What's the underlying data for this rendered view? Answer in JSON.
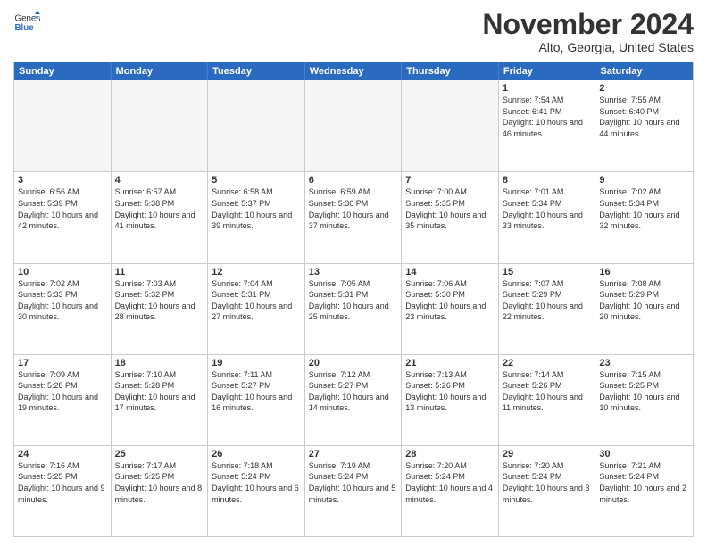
{
  "logo": {
    "general": "General",
    "blue": "Blue"
  },
  "title": "November 2024",
  "location": "Alto, Georgia, United States",
  "days_of_week": [
    "Sunday",
    "Monday",
    "Tuesday",
    "Wednesday",
    "Thursday",
    "Friday",
    "Saturday"
  ],
  "weeks": [
    [
      {
        "day": "",
        "empty": true
      },
      {
        "day": "",
        "empty": true
      },
      {
        "day": "",
        "empty": true
      },
      {
        "day": "",
        "empty": true
      },
      {
        "day": "",
        "empty": true
      },
      {
        "day": "1",
        "sunrise": "Sunrise: 7:54 AM",
        "sunset": "Sunset: 6:41 PM",
        "daylight": "Daylight: 10 hours and 46 minutes."
      },
      {
        "day": "2",
        "sunrise": "Sunrise: 7:55 AM",
        "sunset": "Sunset: 6:40 PM",
        "daylight": "Daylight: 10 hours and 44 minutes."
      }
    ],
    [
      {
        "day": "3",
        "sunrise": "Sunrise: 6:56 AM",
        "sunset": "Sunset: 5:39 PM",
        "daylight": "Daylight: 10 hours and 42 minutes."
      },
      {
        "day": "4",
        "sunrise": "Sunrise: 6:57 AM",
        "sunset": "Sunset: 5:38 PM",
        "daylight": "Daylight: 10 hours and 41 minutes."
      },
      {
        "day": "5",
        "sunrise": "Sunrise: 6:58 AM",
        "sunset": "Sunset: 5:37 PM",
        "daylight": "Daylight: 10 hours and 39 minutes."
      },
      {
        "day": "6",
        "sunrise": "Sunrise: 6:59 AM",
        "sunset": "Sunset: 5:36 PM",
        "daylight": "Daylight: 10 hours and 37 minutes."
      },
      {
        "day": "7",
        "sunrise": "Sunrise: 7:00 AM",
        "sunset": "Sunset: 5:35 PM",
        "daylight": "Daylight: 10 hours and 35 minutes."
      },
      {
        "day": "8",
        "sunrise": "Sunrise: 7:01 AM",
        "sunset": "Sunset: 5:34 PM",
        "daylight": "Daylight: 10 hours and 33 minutes."
      },
      {
        "day": "9",
        "sunrise": "Sunrise: 7:02 AM",
        "sunset": "Sunset: 5:34 PM",
        "daylight": "Daylight: 10 hours and 32 minutes."
      }
    ],
    [
      {
        "day": "10",
        "sunrise": "Sunrise: 7:02 AM",
        "sunset": "Sunset: 5:33 PM",
        "daylight": "Daylight: 10 hours and 30 minutes."
      },
      {
        "day": "11",
        "sunrise": "Sunrise: 7:03 AM",
        "sunset": "Sunset: 5:32 PM",
        "daylight": "Daylight: 10 hours and 28 minutes."
      },
      {
        "day": "12",
        "sunrise": "Sunrise: 7:04 AM",
        "sunset": "Sunset: 5:31 PM",
        "daylight": "Daylight: 10 hours and 27 minutes."
      },
      {
        "day": "13",
        "sunrise": "Sunrise: 7:05 AM",
        "sunset": "Sunset: 5:31 PM",
        "daylight": "Daylight: 10 hours and 25 minutes."
      },
      {
        "day": "14",
        "sunrise": "Sunrise: 7:06 AM",
        "sunset": "Sunset: 5:30 PM",
        "daylight": "Daylight: 10 hours and 23 minutes."
      },
      {
        "day": "15",
        "sunrise": "Sunrise: 7:07 AM",
        "sunset": "Sunset: 5:29 PM",
        "daylight": "Daylight: 10 hours and 22 minutes."
      },
      {
        "day": "16",
        "sunrise": "Sunrise: 7:08 AM",
        "sunset": "Sunset: 5:29 PM",
        "daylight": "Daylight: 10 hours and 20 minutes."
      }
    ],
    [
      {
        "day": "17",
        "sunrise": "Sunrise: 7:09 AM",
        "sunset": "Sunset: 5:28 PM",
        "daylight": "Daylight: 10 hours and 19 minutes."
      },
      {
        "day": "18",
        "sunrise": "Sunrise: 7:10 AM",
        "sunset": "Sunset: 5:28 PM",
        "daylight": "Daylight: 10 hours and 17 minutes."
      },
      {
        "day": "19",
        "sunrise": "Sunrise: 7:11 AM",
        "sunset": "Sunset: 5:27 PM",
        "daylight": "Daylight: 10 hours and 16 minutes."
      },
      {
        "day": "20",
        "sunrise": "Sunrise: 7:12 AM",
        "sunset": "Sunset: 5:27 PM",
        "daylight": "Daylight: 10 hours and 14 minutes."
      },
      {
        "day": "21",
        "sunrise": "Sunrise: 7:13 AM",
        "sunset": "Sunset: 5:26 PM",
        "daylight": "Daylight: 10 hours and 13 minutes."
      },
      {
        "day": "22",
        "sunrise": "Sunrise: 7:14 AM",
        "sunset": "Sunset: 5:26 PM",
        "daylight": "Daylight: 10 hours and 11 minutes."
      },
      {
        "day": "23",
        "sunrise": "Sunrise: 7:15 AM",
        "sunset": "Sunset: 5:25 PM",
        "daylight": "Daylight: 10 hours and 10 minutes."
      }
    ],
    [
      {
        "day": "24",
        "sunrise": "Sunrise: 7:16 AM",
        "sunset": "Sunset: 5:25 PM",
        "daylight": "Daylight: 10 hours and 9 minutes."
      },
      {
        "day": "25",
        "sunrise": "Sunrise: 7:17 AM",
        "sunset": "Sunset: 5:25 PM",
        "daylight": "Daylight: 10 hours and 8 minutes."
      },
      {
        "day": "26",
        "sunrise": "Sunrise: 7:18 AM",
        "sunset": "Sunset: 5:24 PM",
        "daylight": "Daylight: 10 hours and 6 minutes."
      },
      {
        "day": "27",
        "sunrise": "Sunrise: 7:19 AM",
        "sunset": "Sunset: 5:24 PM",
        "daylight": "Daylight: 10 hours and 5 minutes."
      },
      {
        "day": "28",
        "sunrise": "Sunrise: 7:20 AM",
        "sunset": "Sunset: 5:24 PM",
        "daylight": "Daylight: 10 hours and 4 minutes."
      },
      {
        "day": "29",
        "sunrise": "Sunrise: 7:20 AM",
        "sunset": "Sunset: 5:24 PM",
        "daylight": "Daylight: 10 hours and 3 minutes."
      },
      {
        "day": "30",
        "sunrise": "Sunrise: 7:21 AM",
        "sunset": "Sunset: 5:24 PM",
        "daylight": "Daylight: 10 hours and 2 minutes."
      }
    ]
  ]
}
